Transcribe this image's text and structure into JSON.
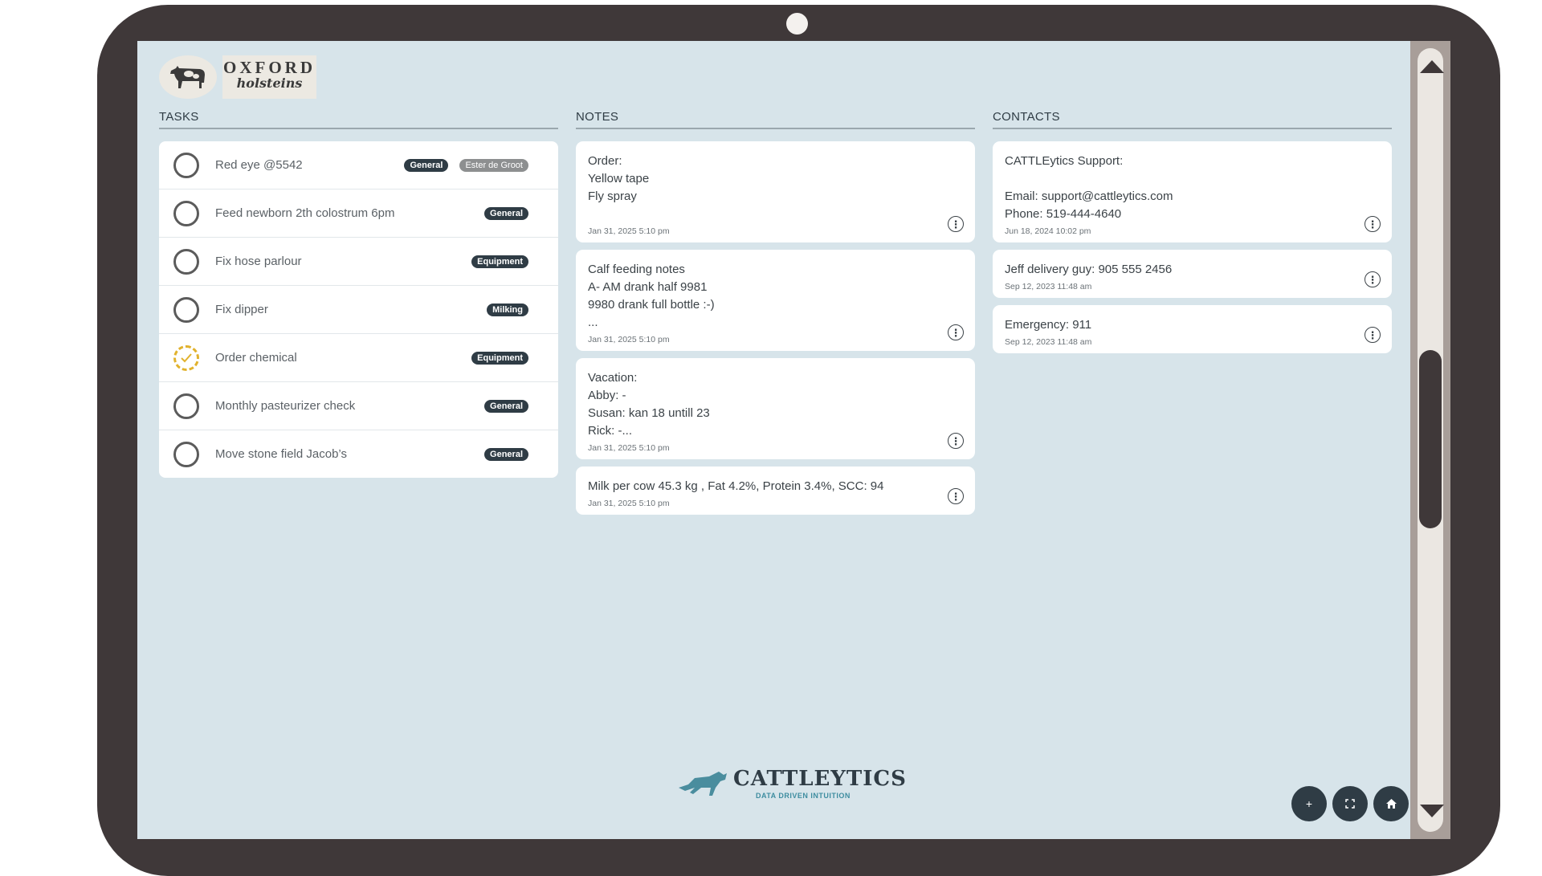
{
  "brand": {
    "farm_name_line1": "OXFORD",
    "farm_name_line2": "holsteins",
    "app_name": "CATTLEYTICS",
    "app_tagline": "DATA DRIVEN INTUITION"
  },
  "tasks": {
    "heading": "TASKS",
    "items": [
      {
        "label": "Red eye @5542",
        "done": false,
        "badges": [
          "General"
        ],
        "person": "Ester de Groot"
      },
      {
        "label": "Feed newborn 2th colostrum 6pm",
        "done": false,
        "badges": [
          "General"
        ],
        "person": null
      },
      {
        "label": "Fix hose parlour",
        "done": false,
        "badges": [
          "Equipment"
        ],
        "person": null
      },
      {
        "label": "Fix dipper",
        "done": false,
        "badges": [
          "Milking"
        ],
        "person": null
      },
      {
        "label": "Order chemical",
        "done": true,
        "badges": [
          "Equipment"
        ],
        "person": null
      },
      {
        "label": "Monthly pasteurizer check",
        "done": false,
        "badges": [
          "General"
        ],
        "person": null
      },
      {
        "label": "Move stone field Jacob’s",
        "done": false,
        "badges": [
          "General"
        ],
        "person": null
      }
    ]
  },
  "notes": {
    "heading": "NOTES",
    "items": [
      {
        "lines": [
          "Order:",
          "Yellow tape",
          "Fly spray",
          ""
        ],
        "date": "Jan 31, 2025 5:10 pm"
      },
      {
        "lines": [
          "Calf feeding notes",
          "A- AM drank half 9981",
          "9980 drank full bottle :-)",
          "..."
        ],
        "date": "Jan 31, 2025 5:10 pm"
      },
      {
        "lines": [
          "Vacation:",
          "Abby: -",
          "Susan: kan 18 untill 23",
          "Rick: -..."
        ],
        "date": "Jan 31, 2025 5:10 pm"
      },
      {
        "lines": [
          "Milk per cow 45.3 kg , Fat 4.2%, Protein 3.4%, SCC: 94"
        ],
        "date": "Jan 31, 2025 5:10 pm"
      }
    ]
  },
  "contacts": {
    "heading": "CONTACTS",
    "items": [
      {
        "lines": [
          "CATTLEytics Support:",
          "",
          "Email: support@cattleytics.com",
          "Phone: 519-444-4640"
        ],
        "date": "Jun 18, 2024 10:02 pm"
      },
      {
        "lines": [
          "Jeff delivery guy: 905 555 2456"
        ],
        "date": "Sep 12, 2023 11:48 am"
      },
      {
        "lines": [
          "Emergency: 911"
        ],
        "date": "Sep 12, 2023 11:48 am"
      }
    ]
  },
  "actions": {
    "add_icon": "plus-icon",
    "fullscreen_icon": "fullscreen-icon",
    "home_icon": "home-icon"
  },
  "colors": {
    "screen_bg": "#d7e4ea",
    "badge_bg": "#2f3c45",
    "done_accent": "#e1b22d",
    "bezel": "#3f3839"
  }
}
